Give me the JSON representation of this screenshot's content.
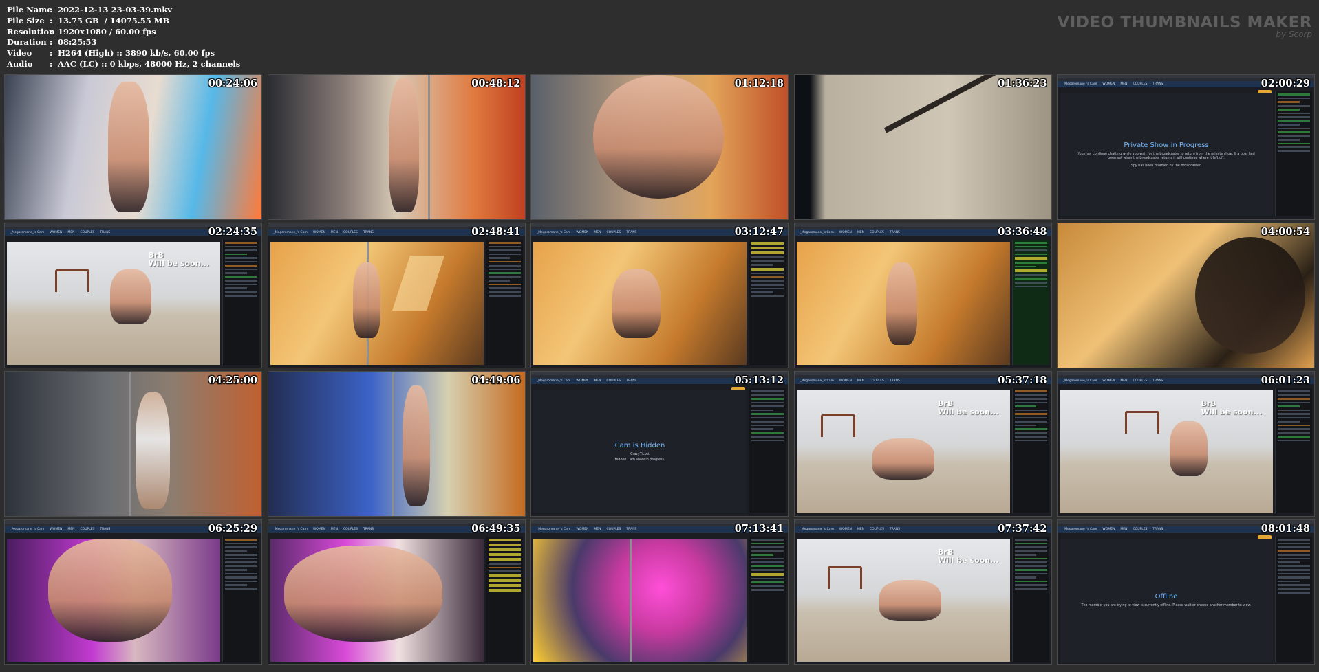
{
  "file_info": [
    {
      "key": "File Name",
      "value": "2022-12-13 23-03-39.mkv"
    },
    {
      "key": "File Size",
      "value": "13.75 GB  / 14075.55 MB"
    },
    {
      "key": "Resolution",
      "value": "1920x1080 / 60.00 fps"
    },
    {
      "key": "Duration",
      "value": "08:25:53"
    },
    {
      "key": "Video",
      "value": "H264 (High) :: 3890 kb/s, 60.00 fps"
    },
    {
      "key": "Audio",
      "value": "AAC (LC) :: 0 kbps, 48000 Hz, 2 channels"
    }
  ],
  "brand": {
    "title": "VIDEO THUMBNAILS MAKER",
    "subtitle": "by Scorp"
  },
  "thumbnails": [
    {
      "time": "00:24:06"
    },
    {
      "time": "00:48:12"
    },
    {
      "time": "01:12:18"
    },
    {
      "time": "01:36:23"
    },
    {
      "time": "02:00:29",
      "overlay_title": "Private Show in Progress",
      "overlay_text": "You may continue chatting while you wait for the broadcaster to return from the private show. If a goal had been set when the broadcaster returns it will continue where it left off.",
      "overlay_text2": "Spy has been disabled by the broadcaster."
    },
    {
      "time": "02:24:35",
      "brb": "BrB",
      "brb2": "Will  be soon..."
    },
    {
      "time": "02:48:41"
    },
    {
      "time": "03:12:47"
    },
    {
      "time": "03:36:48"
    },
    {
      "time": "04:00:54"
    },
    {
      "time": "04:25:00"
    },
    {
      "time": "04:49:06"
    },
    {
      "time": "05:13:12",
      "overlay_title": "Cam is Hidden",
      "overlay_text": "CrazyTicket",
      "overlay_text2": "Hidden Cam show in progress."
    },
    {
      "time": "05:37:18",
      "brb": "BrB",
      "brb2": "Will  be soon..."
    },
    {
      "time": "06:01:23",
      "brb": "BrB",
      "brb2": "Will  be soon..."
    },
    {
      "time": "06:25:29"
    },
    {
      "time": "06:49:35"
    },
    {
      "time": "07:13:41"
    },
    {
      "time": "07:37:42",
      "brb": "BrB",
      "brb2": "Will  be soon..."
    },
    {
      "time": "08:01:48",
      "overlay_title": "Offline",
      "overlay_text": "The member you are trying to view is currently offline. Please wait or choose another member to view."
    }
  ],
  "site_nav": [
    "_Megaromane_'s Cam",
    "WOMEN",
    "MEN",
    "COUPLES",
    "TRANS"
  ]
}
